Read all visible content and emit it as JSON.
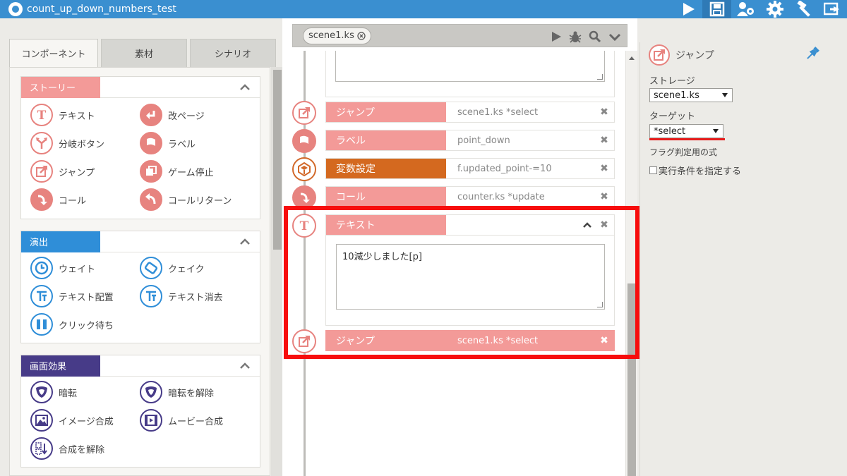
{
  "window": {
    "title": "count_up_down_numbers_test"
  },
  "toolbar": {
    "icons": [
      "play-icon",
      "save-icon",
      "settings-users-icon",
      "gear-icon",
      "build-icon",
      "export-icon"
    ]
  },
  "left": {
    "tabs": [
      "コンポーネント",
      "素材",
      "シナリオ"
    ],
    "categories": [
      {
        "title": "ストーリー",
        "color": "#f39a98",
        "items": [
          "テキスト",
          "改ページ",
          "分岐ボタン",
          "ラベル",
          "ジャンプ",
          "ゲーム停止",
          "コール",
          "コールリターン"
        ]
      },
      {
        "title": "演出",
        "color": "#2f8ed8",
        "items": [
          "ウェイト",
          "クェイク",
          "テキスト配置",
          "テキスト消去",
          "クリック待ち"
        ]
      },
      {
        "title": "画面効果",
        "color": "#473b88",
        "items": [
          "暗転",
          "暗転を解除",
          "イメージ合成",
          "ムービー合成",
          "合成を解除"
        ]
      }
    ]
  },
  "center": {
    "file_tab": "scene1.ks",
    "rows": [
      {
        "label": "ジャンプ",
        "param": "scene1.ks *select"
      },
      {
        "label": "ラベル",
        "param": "point_down"
      },
      {
        "label": "変数設定",
        "param": "f.updated_point-=10"
      },
      {
        "label": "コール",
        "param": "counter.ks *update"
      },
      {
        "label": "テキスト",
        "param": ""
      },
      {
        "label": "ジャンプ",
        "param": "scene1.ks *select"
      }
    ],
    "text_body": "10減少しました[p]",
    "colors": {
      "pink": "#f39a98",
      "orange": "#d4691f"
    }
  },
  "right": {
    "title": "ジャンプ",
    "storage_label": "ストレージ",
    "storage_value": "scene1.ks",
    "target_label": "ターゲット",
    "target_value": "*select",
    "flag_label": "フラグ判定用の式",
    "condition_label": "実行条件を指定する"
  }
}
